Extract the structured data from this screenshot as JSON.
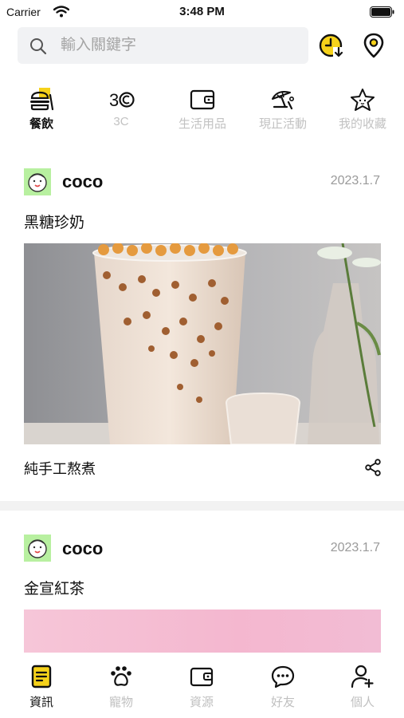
{
  "status_bar": {
    "carrier": "Carrier",
    "time": "3:48 PM"
  },
  "search": {
    "placeholder": "輸入關鍵字"
  },
  "categories": [
    {
      "label": "餐飲",
      "icon": "food-icon",
      "active": true
    },
    {
      "label": "3C",
      "icon": "3c-icon",
      "active": false
    },
    {
      "label": "生活用品",
      "icon": "wallet-icon",
      "active": false
    },
    {
      "label": "現正活動",
      "icon": "beach-icon",
      "active": false
    },
    {
      "label": "我的收藏",
      "icon": "star-icon",
      "active": false
    }
  ],
  "posts": [
    {
      "author": "coco",
      "date": "2023.1.7",
      "title": "黑糖珍奶",
      "caption": "純手工熬煮"
    },
    {
      "author": "coco",
      "date": "2023.1.7",
      "title": "金宣紅茶"
    }
  ],
  "tabs": [
    {
      "label": "資訊",
      "icon": "news-icon",
      "active": true
    },
    {
      "label": "寵物",
      "icon": "paw-icon",
      "active": false
    },
    {
      "label": "資源",
      "icon": "wallet-icon",
      "active": false
    },
    {
      "label": "好友",
      "icon": "chat-icon",
      "active": false
    },
    {
      "label": "個人",
      "icon": "add-user-icon",
      "active": false
    }
  ],
  "colors": {
    "accent": "#f6d21a",
    "active_text": "#111111",
    "inactive_text": "#c0c0c0",
    "avatar_bg": "#b8f0a0"
  }
}
